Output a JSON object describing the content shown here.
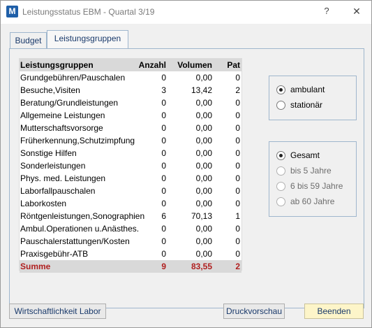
{
  "window": {
    "app_icon_letter": "M",
    "title": "Leistungsstatus EBM - Quartal 3/19",
    "help_glyph": "?",
    "close_glyph": "✕"
  },
  "tabs": [
    {
      "label": "Budget",
      "active": false
    },
    {
      "label": "Leistungsgruppen",
      "active": true
    }
  ],
  "table": {
    "headers": [
      "Leistungsgruppen",
      "Anzahl",
      "Volumen",
      "Pat"
    ],
    "rows": [
      [
        "Grundgebühren/Pauschalen",
        "0",
        "0,00",
        "0"
      ],
      [
        "Besuche,Visiten",
        "3",
        "13,42",
        "2"
      ],
      [
        "Beratung/Grundleistungen",
        "0",
        "0,00",
        "0"
      ],
      [
        "Allgemeine Leistungen",
        "0",
        "0,00",
        "0"
      ],
      [
        "Mutterschaftsvorsorge",
        "0",
        "0,00",
        "0"
      ],
      [
        "Früherkennung,Schutzimpfung",
        "0",
        "0,00",
        "0"
      ],
      [
        "Sonstige Hilfen",
        "0",
        "0,00",
        "0"
      ],
      [
        "Sonderleistungen",
        "0",
        "0,00",
        "0"
      ],
      [
        "Phys. med. Leistungen",
        "0",
        "0,00",
        "0"
      ],
      [
        "Laborfallpauschalen",
        "0",
        "0,00",
        "0"
      ],
      [
        "Laborkosten",
        "0",
        "0,00",
        "0"
      ],
      [
        "Röntgenleistungen,Sonographien",
        "6",
        "70,13",
        "1"
      ],
      [
        "Ambul.Operationen u.Anästhes.",
        "0",
        "0,00",
        "0"
      ],
      [
        "Pauschalerstattungen/Kosten",
        "0",
        "0,00",
        "0"
      ],
      [
        "Praxisgebühr-ATB",
        "0",
        "0,00",
        "0"
      ]
    ],
    "total": [
      "Summe",
      "9",
      "83,55",
      "2"
    ]
  },
  "care_type": {
    "options": [
      {
        "label": "ambulant",
        "checked": true,
        "enabled": true
      },
      {
        "label": "stationär",
        "checked": false,
        "enabled": true
      }
    ]
  },
  "age_group": {
    "options": [
      {
        "label": "Gesamt",
        "checked": true,
        "enabled": true
      },
      {
        "label": "bis 5 Jahre",
        "checked": false,
        "enabled": false
      },
      {
        "label": "6 bis 59 Jahre",
        "checked": false,
        "enabled": false
      },
      {
        "label": "ab 60 Jahre",
        "checked": false,
        "enabled": false
      }
    ]
  },
  "buttons": {
    "labor": "Wirtschaftlichkeit Labor",
    "druck": "Druckvorschau",
    "beenden": "Beenden"
  },
  "colors": {
    "total_text": "#b02020",
    "header_bg": "#d9d9d9",
    "beenden_bg": "#fdf5c9",
    "app_icon": "#1f5fa8"
  }
}
